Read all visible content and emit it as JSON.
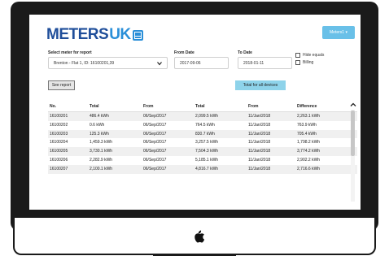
{
  "header": {
    "logo_main": "METERS",
    "logo_accent": "UK",
    "user_button": "Meters1 ▾"
  },
  "filters": {
    "meter_label": "Select meter for report",
    "meter_value": "Brenton - Flat 1, ID: 16100201,39",
    "from_label": "From Date",
    "from_value": "2017-09-06",
    "to_label": "To Date",
    "to_value": "2018-01-11",
    "hide_equals": "Hide equals",
    "billing": "Billing"
  },
  "actions": {
    "see_report": "See report",
    "total_all": "Total for all devices"
  },
  "table": {
    "headers": [
      "No.",
      "Total",
      "From",
      "Total",
      "From",
      "Difference"
    ],
    "rows": [
      [
        "16100201",
        "486.4 kWh",
        "06/Sep/2017",
        "2,099.5 kWh",
        "11/Jan/2018",
        "2,263.1 kWh"
      ],
      [
        "16100202",
        "0.6 kWh",
        "06/Sep/2017",
        "764.5 kWh",
        "11/Jan/2018",
        "763.9 kWh"
      ],
      [
        "16100203",
        "125.3 kWh",
        "06/Sep/2017",
        "830.7 kWh",
        "11/Jan/2018",
        "705.4 kWh"
      ],
      [
        "16100204",
        "1,459.3 kWh",
        "06/Sep/2017",
        "3,257.5 kWh",
        "11/Jan/2018",
        "1,798.2 kWh"
      ],
      [
        "16100205",
        "3,730.1 kWh",
        "06/Sep/2017",
        "7,504.3 kWh",
        "11/Jan/2018",
        "3,774.2 kWh"
      ],
      [
        "16100206",
        "2,282.9 kWh",
        "06/Sep/2017",
        "5,185.1 kWh",
        "11/Jan/2018",
        "2,902.2 kWh"
      ],
      [
        "16100207",
        "2,100.1 kWh",
        "06/Sep/2017",
        "4,816.7 kWh",
        "11/Jan/2018",
        "2,716.6 kWh"
      ]
    ]
  },
  "colors": {
    "brand": "#1f4e9a",
    "accent": "#2a8fd8",
    "button_blue": "#69c0e8",
    "bezel": "#1a1a1a"
  },
  "icons": [
    "apple-icon",
    "chevron-down-icon",
    "chevron-up-icon"
  ]
}
